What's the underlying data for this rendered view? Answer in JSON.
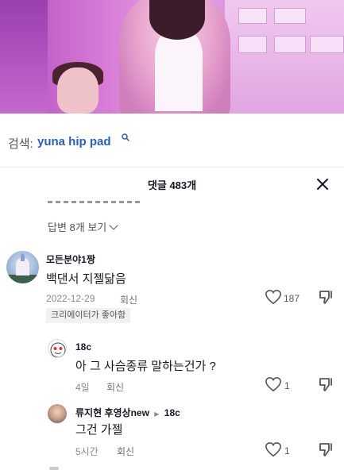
{
  "search": {
    "prefix": "검색:",
    "query": "yuna hip pad"
  },
  "header": {
    "comment_count_label": "댓글 483개"
  },
  "replies_link": "답변 8개 보기",
  "comments": [
    {
      "author": "모든분야1짱",
      "text": "백댄서 지젤닮음",
      "date": "2022-12-29",
      "reply_label": "회신",
      "likes": "187",
      "badge": "크리에이터가 좋아함",
      "replies": [
        {
          "author": "18c",
          "text": "아 그 사슴종류 말하는건가 ?",
          "date": "4일",
          "reply_label": "회신",
          "likes": "1"
        },
        {
          "author": "류지현 후영상new",
          "reply_to": "18c",
          "text": "그건 가젤",
          "date": "5시간",
          "reply_label": "회신",
          "likes": "1"
        }
      ]
    }
  ],
  "colors": {
    "link_blue": "#2b5fb8",
    "meta_gray": "#8a8a8a",
    "badge_bg": "#f1f1f2"
  },
  "icons": [
    "search-icon",
    "close-icon",
    "chevron-down-icon",
    "heart-icon",
    "dislike-icon"
  ]
}
